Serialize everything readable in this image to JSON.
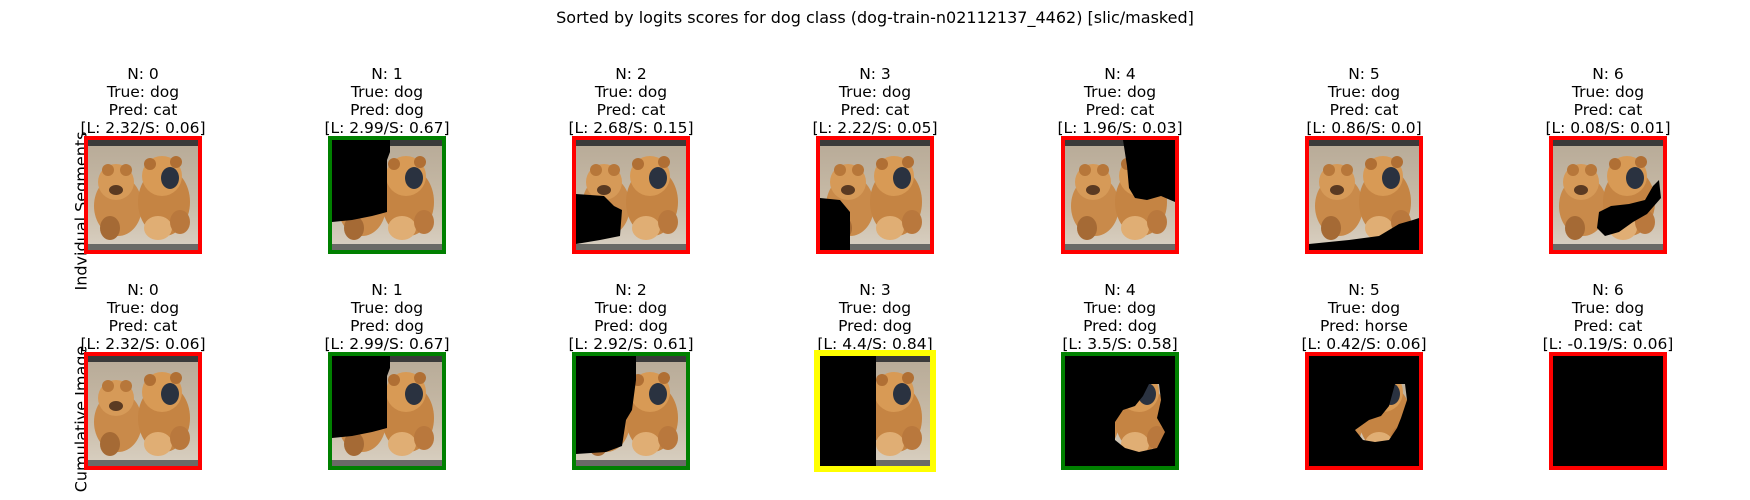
{
  "title": "Sorted by logits scores for dog class (dog-train-n02112137_4462) [slic/masked]",
  "rows": [
    {
      "label": "Indvidual Segments",
      "cells": [
        {
          "n": "N: 0",
          "true_label": "True: dog",
          "pred": "Pred: cat",
          "scores": "[L: 2.32/S: 0.06]",
          "border": "red",
          "mask": "none"
        },
        {
          "n": "N: 1",
          "true_label": "True: dog",
          "pred": "Pred: dog",
          "scores": "[L: 2.99/S: 0.67]",
          "border": "green",
          "mask": "left-half"
        },
        {
          "n": "N: 2",
          "true_label": "True: dog",
          "pred": "Pred: cat",
          "scores": "[L: 2.68/S: 0.15]",
          "border": "red",
          "mask": "lower-left"
        },
        {
          "n": "N: 3",
          "true_label": "True: dog",
          "pred": "Pred: cat",
          "scores": "[L: 2.22/S: 0.05]",
          "border": "red",
          "mask": "left-strip"
        },
        {
          "n": "N: 4",
          "true_label": "True: dog",
          "pred": "Pred: cat",
          "scores": "[L: 1.96/S: 0.03]",
          "border": "red",
          "mask": "upper-right"
        },
        {
          "n": "N: 5",
          "true_label": "True: dog",
          "pred": "Pred: cat",
          "scores": "[L: 0.86/S: 0.0]",
          "border": "red",
          "mask": "bottom"
        },
        {
          "n": "N: 6",
          "true_label": "True: dog",
          "pred": "Pred: cat",
          "scores": "[L: 0.08/S: 0.01]",
          "border": "red",
          "mask": "center-blob"
        }
      ]
    },
    {
      "label": "Cumulative Image",
      "cells": [
        {
          "n": "N: 0",
          "true_label": "True: dog",
          "pred": "Pred: cat",
          "scores": "[L: 2.32/S: 0.06]",
          "border": "red",
          "mask": "none"
        },
        {
          "n": "N: 1",
          "true_label": "True: dog",
          "pred": "Pred: dog",
          "scores": "[L: 2.99/S: 0.67]",
          "border": "green",
          "mask": "left-half"
        },
        {
          "n": "N: 2",
          "true_label": "True: dog",
          "pred": "Pred: dog",
          "scores": "[L: 2.92/S: 0.61]",
          "border": "green",
          "mask": "left-half-more"
        },
        {
          "n": "N: 3",
          "true_label": "True: dog",
          "pred": "Pred: dog",
          "scores": "[L: 4.4/S: 0.84]",
          "border": "yellow",
          "mask": "left-half-full"
        },
        {
          "n": "N: 4",
          "true_label": "True: dog",
          "pred": "Pred: dog",
          "scores": "[L: 3.5/S: 0.58]",
          "border": "green",
          "mask": "mostly-black"
        },
        {
          "n": "N: 5",
          "true_label": "True: dog",
          "pred": "Pred: horse",
          "scores": "[L: 0.42/S: 0.06]",
          "border": "red",
          "mask": "small-blob"
        },
        {
          "n": "N: 6",
          "true_label": "True: dog",
          "pred": "Pred: cat",
          "scores": "[L: -0.19/S: 0.06]",
          "border": "red",
          "mask": "all-black"
        }
      ]
    }
  ]
}
